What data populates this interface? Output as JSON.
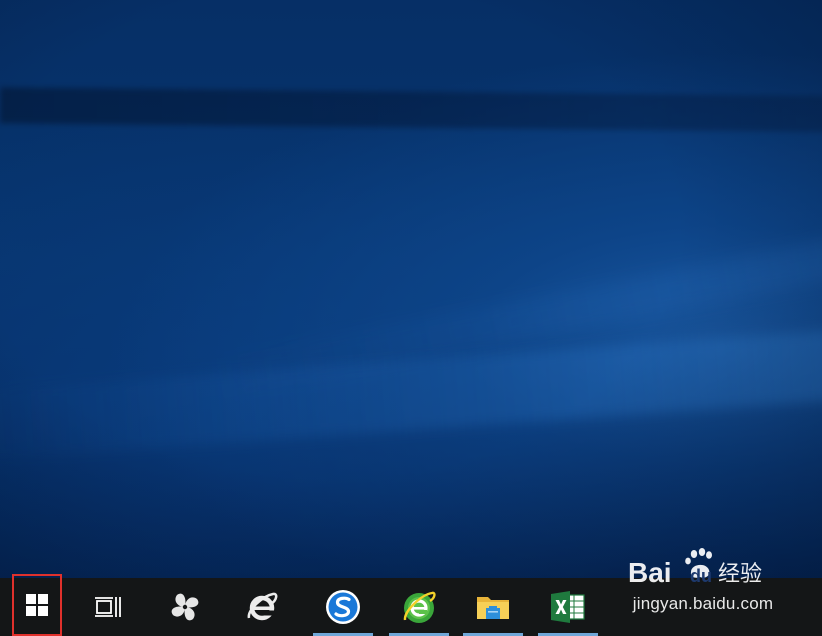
{
  "desktop": {
    "wallpaper": "windows-10-hero-blue"
  },
  "watermark": {
    "brand": "Bai du 经验",
    "url": "jingyan.baidu.com"
  },
  "taskbar": {
    "start": {
      "icon": "windows-logo-icon",
      "highlight_color": "#e0312c"
    },
    "task_view": {
      "icon": "task-view-icon"
    },
    "apps": [
      {
        "icon": "pinwheel-app-icon",
        "running": false
      },
      {
        "icon": "internet-explorer-icon",
        "running": false
      },
      {
        "icon": "sogou-browser-icon",
        "running": true
      },
      {
        "icon": "360-browser-icon",
        "running": true
      },
      {
        "icon": "file-explorer-icon",
        "running": true
      },
      {
        "icon": "excel-icon",
        "running": true
      }
    ],
    "indicator_color": "#6fa7d8",
    "background": "#141617"
  }
}
